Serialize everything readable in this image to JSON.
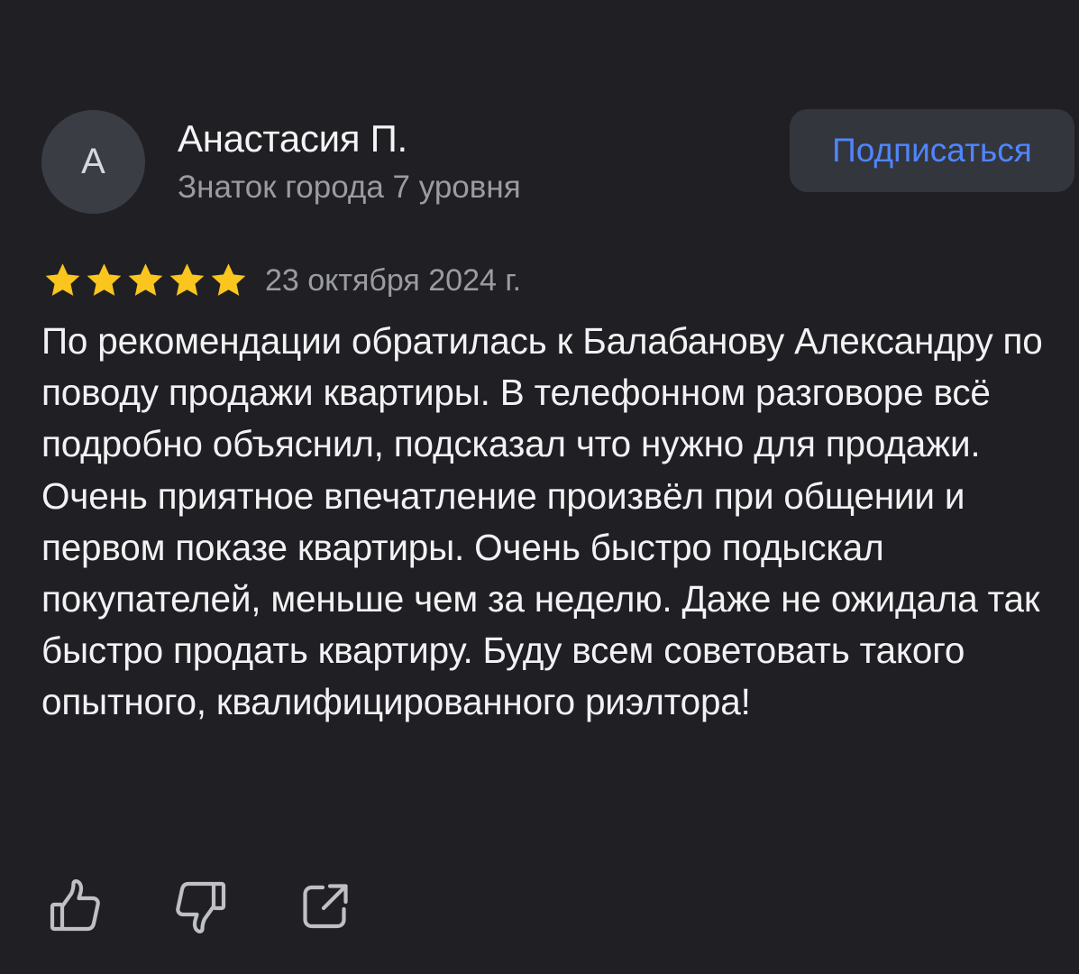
{
  "author": {
    "avatar_letter": "А",
    "name": "Анастасия П.",
    "level": "Знаток города 7 уровня"
  },
  "subscribe_label": "Подписаться",
  "rating": {
    "stars": 5,
    "max": 5,
    "date": "23 октября 2024 г."
  },
  "review_text": "По рекомендации обратилась к Балабанову Александру по поводу продажи квартиры. В телефонном разговоре всё подробно объяснил, подсказал что нужно для продажи. Очень приятное впечатление произвёл при общении и первом показе квартиры. Очень быстро подыскал покупателей, меньше чем за неделю. Даже не ожидала так быстро продать квартиру. Буду всем советовать такого опытного, квалифицированного риэлтора!",
  "actions": {
    "like_icon": "thumbs-up-icon",
    "dislike_icon": "thumbs-down-icon",
    "share_icon": "share-icon"
  },
  "colors": {
    "background": "#202024",
    "accent": "#4f86ff",
    "star": "#f9c51e",
    "muted_text": "#9b9ca2"
  }
}
